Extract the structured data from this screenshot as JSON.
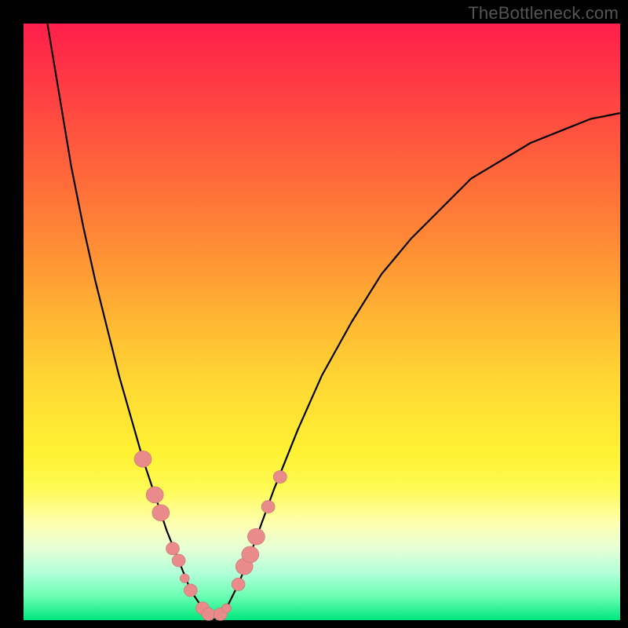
{
  "watermark": "TheBottleneck.com",
  "chart_data": {
    "type": "line",
    "title": "",
    "xlabel": "",
    "ylabel": "",
    "xlim": [
      0,
      100
    ],
    "ylim": [
      0,
      100
    ],
    "grid": false,
    "legend": false,
    "background_gradient": {
      "top": "#ff1f4b",
      "bottom": "#00e77e",
      "meaning": "vertical gradient from red (high bottleneck) to green (low bottleneck)"
    },
    "series": [
      {
        "name": "bottleneck-curve",
        "color": "#000000",
        "x": [
          4,
          6,
          8,
          10,
          12,
          14,
          16,
          18,
          20,
          22,
          24,
          26,
          28,
          30,
          32,
          34,
          36,
          38,
          42,
          46,
          50,
          55,
          60,
          65,
          70,
          75,
          80,
          85,
          90,
          95,
          100
        ],
        "y": [
          100,
          88,
          76,
          66,
          57,
          49,
          41,
          34,
          27,
          21,
          15,
          10,
          5,
          2,
          0,
          2,
          6,
          11,
          22,
          32,
          41,
          50,
          58,
          64,
          69,
          74,
          77,
          80,
          82,
          84,
          85
        ]
      }
    ],
    "markers": {
      "name": "highlighted-points",
      "color": "#e98b8a",
      "points": [
        {
          "x": 20,
          "y": 27,
          "size": "lg"
        },
        {
          "x": 22,
          "y": 21,
          "size": "lg"
        },
        {
          "x": 23,
          "y": 18,
          "size": "lg"
        },
        {
          "x": 25,
          "y": 12,
          "size": "md"
        },
        {
          "x": 26,
          "y": 10,
          "size": "md"
        },
        {
          "x": 27,
          "y": 7,
          "size": "sm"
        },
        {
          "x": 28,
          "y": 5,
          "size": "md"
        },
        {
          "x": 30,
          "y": 2,
          "size": "md"
        },
        {
          "x": 31,
          "y": 1,
          "size": "md"
        },
        {
          "x": 33,
          "y": 1,
          "size": "md"
        },
        {
          "x": 34,
          "y": 2,
          "size": "sm"
        },
        {
          "x": 36,
          "y": 6,
          "size": "md"
        },
        {
          "x": 37,
          "y": 9,
          "size": "lg"
        },
        {
          "x": 38,
          "y": 11,
          "size": "lg"
        },
        {
          "x": 39,
          "y": 14,
          "size": "lg"
        },
        {
          "x": 41,
          "y": 19,
          "size": "md"
        },
        {
          "x": 43,
          "y": 24,
          "size": "md"
        }
      ]
    },
    "minimum": {
      "x": 32,
      "y": 0
    }
  }
}
